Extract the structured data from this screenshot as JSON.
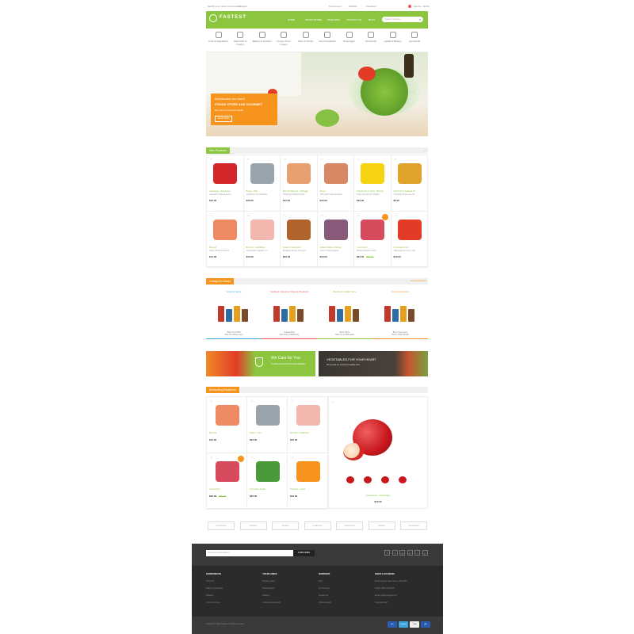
{
  "topbar": {
    "left": [
      "Modify your Order Confirmation",
      "My Account",
      "English"
    ],
    "right": [
      "My Account",
      "Wishlist",
      "Checkout"
    ],
    "cart_label": "Item(s) - $0.00",
    "cart_count": "0"
  },
  "header": {
    "logo": "FASTEST",
    "nav": [
      "HOME",
      "SPORT STORE",
      "FEATURES",
      "CONTACT US",
      "BLOG"
    ],
    "search_placeholder": "Search products..."
  },
  "categories": [
    "Fruit & Vegetables",
    "Meat Fish & Poultry",
    "Bakery & Cookies",
    "Frozen & Ice Cream",
    "Wine & Drinks",
    "Food Cupboard",
    "Beverages",
    "Hot Foods",
    "Health & Beauty",
    "Household"
  ],
  "hero": {
    "line1": "Introduction our store",
    "line2": "FOODS STORE AND GOURMET",
    "line3": "Be more to Gourmet health",
    "button": "SHOP NOW"
  },
  "new_products": {
    "title": "New Products",
    "items": [
      {
        "cat": "Asparagus - Artichokes",
        "desc": "Vegetables Natural sed ut",
        "price": "$13.00",
        "old": "",
        "color": "#d4252a"
      },
      {
        "cat": "Beans - Fish",
        "desc": "Nostrud ex nun servitude",
        "price": "$22.00",
        "old": "",
        "color": "#9aa4ad"
      },
      {
        "cat": "Broccoli Biscuits - Cabbage",
        "desc": "Cutting all components fit",
        "price": "$11.00",
        "old": "",
        "color": "#e8a070"
      },
      {
        "cat": "Soups",
        "desc": "With good crops and citrus",
        "price": "$15.00",
        "old": "",
        "color": "#d98866"
      },
      {
        "cat": "Cold Fruits & Juices - Berries",
        "desc": "Keep you and your families",
        "price": "$19.00",
        "old": "",
        "color": "#f5d311"
      },
      {
        "cat": "Fish Fruit & Seafood Fit",
        "desc": "Rosemary all you can ski",
        "price": "$5.00",
        "old": "",
        "color": "#e0a42a"
      },
      {
        "cat": "Broccoli",
        "desc": "Gluten Products dieters",
        "price": "$14.00",
        "old": "",
        "color": "#f08a62"
      },
      {
        "cat": "Broccoli - Cauliflower",
        "desc": "Work ideal to shoulder us",
        "price": "$15.00",
        "old": "",
        "color": "#f2b8b0"
      },
      {
        "cat": "Bread & Mushroom",
        "desc": "Breakfast all over the menu",
        "price": "$22.00",
        "old": "",
        "color": "#b0632b"
      },
      {
        "cat": "Grilled Patties & Burger",
        "desc": "Gluten Products dieter",
        "price": "$15.00",
        "old": "",
        "color": "#8a5a7a"
      },
      {
        "cat": "Cucumbers",
        "desc": "Pickled all kinds spiced",
        "price": "$22.00",
        "old": "$33.00",
        "color": "#d84a5e",
        "sale": true
      },
      {
        "cat": "Chocolate Fruits",
        "desc": "Balancing the in for a vibe",
        "price": "$16.00",
        "old": "",
        "color": "#e23b26"
      }
    ]
  },
  "deals": {
    "title": "Categories Deals",
    "view_all": "see all categories",
    "cols": [
      {
        "title": "Grocery Items",
        "color": "#3aa6dd",
        "cap1": "Save Up to 50%",
        "cap2": "Plus free Gift in every"
      },
      {
        "title": "Seafood, Foods & Cheese Products",
        "color": "#f04e4e",
        "cap1": "Lowest Price",
        "cap2": "Plus 10% on 5000 only"
      },
      {
        "title": "Beauty & Health Care",
        "color": "#8cc63f",
        "cap1": "Best Offers",
        "cap2": "Save Up to 50% deals"
      },
      {
        "title": "Frozen products",
        "color": "#f7941d",
        "cap1": "Buy 1 Get 1 Free",
        "cap2": "Plus on 50% off bulk"
      }
    ]
  },
  "banners": {
    "left_title": "We Care for You",
    "left_text": "Certified products from brands worldwide",
    "right_title": "VEGETABLES FOR YOUR HEART",
    "right_text": "We provide our customers healthy food"
  },
  "bestselling": {
    "title": "Bestselling Medicines",
    "items": [
      {
        "cat": "Broccoli",
        "price": "$14.00",
        "old": "",
        "color": "#f08a62"
      },
      {
        "cat": "Beans - Fish",
        "price": "$22.00",
        "old": "",
        "color": "#9aa4ad"
      },
      {
        "cat": "Broccoli - Cauliflower",
        "price": "$15.00",
        "old": "",
        "color": "#f2b8b0"
      },
      {
        "cat": "Cucumbers",
        "price": "$22.00",
        "old": "$33.00",
        "color": "#d84a5e",
        "sale": true
      },
      {
        "cat": "Cucumber Seeds",
        "price": "$25.00",
        "old": "",
        "color": "#4a9a3a"
      },
      {
        "cat": "Pumpkin - Limes",
        "price": "$13.00",
        "old": "",
        "color": "#f7941d"
      }
    ],
    "featured": {
      "cat": "Asparagus - Artichokes",
      "price": "$13.00"
    }
  },
  "brands": [
    "freshlocal",
    "bubble",
    "shuttle",
    "healthyst",
    "freshlocal",
    "bubble",
    "freshlocal"
  ],
  "footer": {
    "newsletter_placeholder": "Enter your email address",
    "subscribe": "SUBSCRIBE",
    "social": [
      "f",
      "t",
      "g",
      "p",
      "i",
      "y"
    ],
    "cols": [
      {
        "h": "CORPORATE",
        "items": [
          "About Us",
          "Delivery Information",
          "Affiliates",
          "Terms of Service"
        ]
      },
      {
        "h": "YOUR LINKS",
        "items": [
          "Shipping guide",
          "Manufacturers",
          "Affiliates",
          "Customer and Quality"
        ]
      },
      {
        "h": "SUPPORT",
        "items": [
          "FAQ",
          "Our Services",
          "Contact Us",
          "Online Support"
        ]
      },
      {
        "h": "SHOP LOCATION",
        "items": [
          "Broad Avenue, New Jersey, USA 1234",
          "Hotline: 800 1234 5678",
          "Email: info@example.com",
          "Copyright 2017"
        ]
      }
    ],
    "copyright": "Copyright © 2017 Fastest. All rights reserved.",
    "payments": [
      "MC",
      "PayPal",
      "VISA",
      "AE"
    ]
  }
}
